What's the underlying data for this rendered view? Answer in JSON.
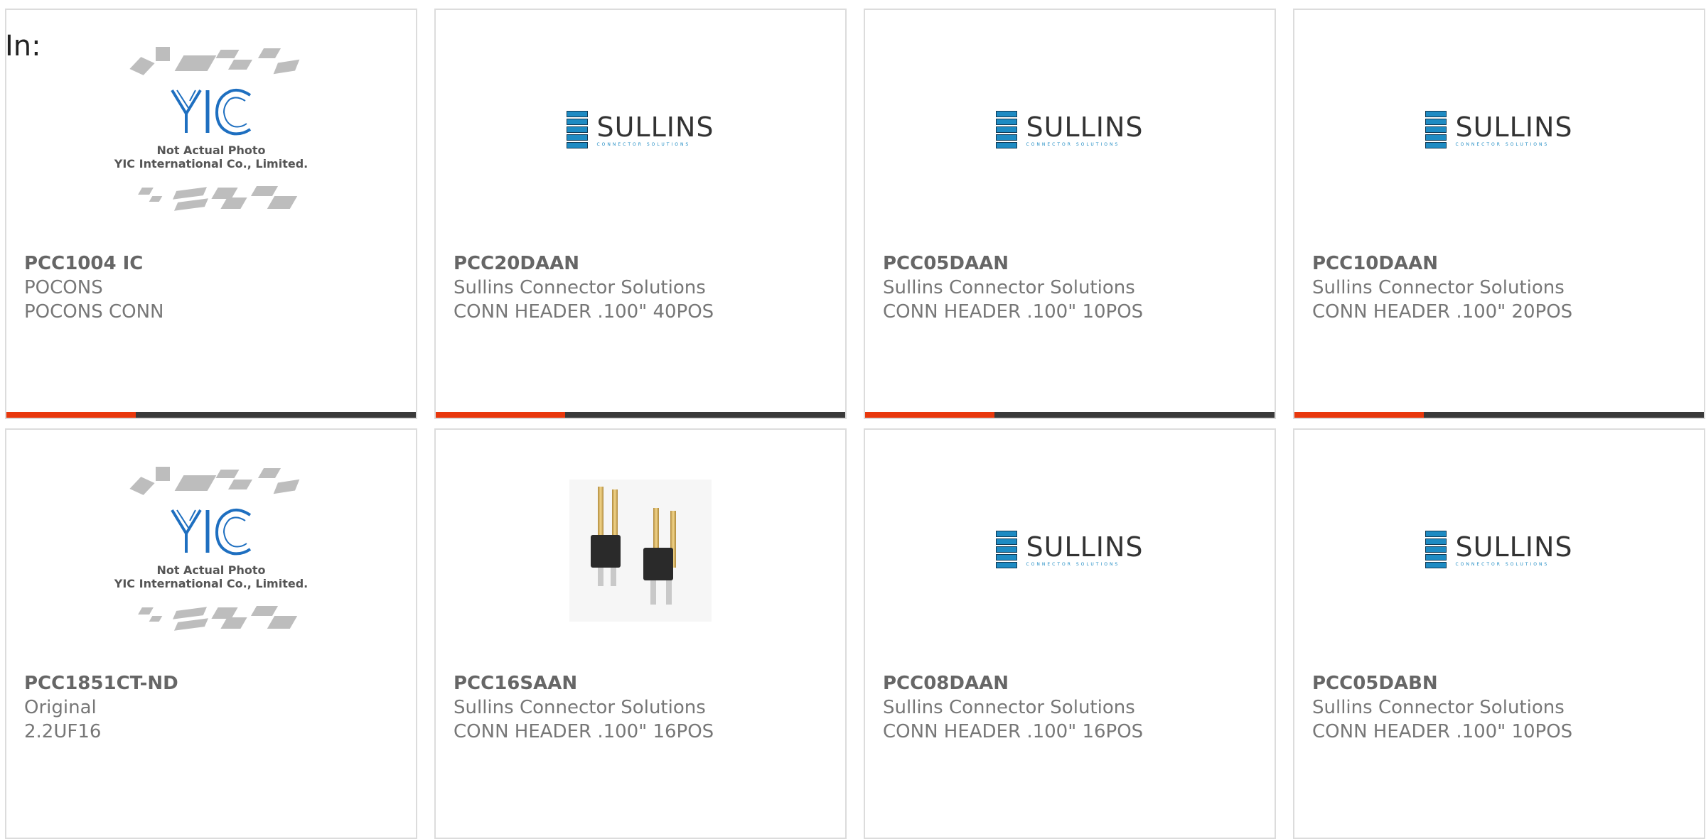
{
  "page": {
    "filter_label": "In:"
  },
  "colors": {
    "accent": "#e8380d",
    "bar_dark": "#3a3a3a",
    "sullins_blue": "#1e8bc3",
    "card_border": "#dcdcdc"
  },
  "placeholder": {
    "line1": "Not Actual Photo",
    "line2": "YIC International Co., Limited."
  },
  "sullins_logo": {
    "brand": "SULLINS",
    "tagline": "CONNECTOR SOLUTIONS"
  },
  "products": [
    {
      "part": "PCC1004 IC",
      "manufacturer": "POCONS",
      "description": "POCONS CONN",
      "image": "yic-placeholder-icon"
    },
    {
      "part": "PCC20DAAN",
      "manufacturer": "Sullins Connector Solutions",
      "description": "CONN HEADER .100\" 40POS",
      "image": "sullins-logo-icon"
    },
    {
      "part": "PCC05DAAN",
      "manufacturer": "Sullins Connector Solutions",
      "description": "CONN HEADER .100\" 10POS",
      "image": "sullins-logo-icon"
    },
    {
      "part": "PCC10DAAN",
      "manufacturer": "Sullins Connector Solutions",
      "description": "CONN HEADER .100\" 20POS",
      "image": "sullins-logo-icon"
    },
    {
      "part": "PCC1851CT-ND",
      "manufacturer": "Original",
      "description": "2.2UF16",
      "image": "yic-placeholder-icon"
    },
    {
      "part": "PCC16SAAN",
      "manufacturer": "Sullins Connector Solutions",
      "description": "CONN HEADER .100\" 16POS",
      "image": "pin-header-photo"
    },
    {
      "part": "PCC08DAAN",
      "manufacturer": "Sullins Connector Solutions",
      "description": "CONN HEADER .100\" 16POS",
      "image": "sullins-logo-icon"
    },
    {
      "part": "PCC05DABN",
      "manufacturer": "Sullins Connector Solutions",
      "description": "CONN HEADER .100\" 10POS",
      "image": "sullins-logo-icon"
    }
  ]
}
